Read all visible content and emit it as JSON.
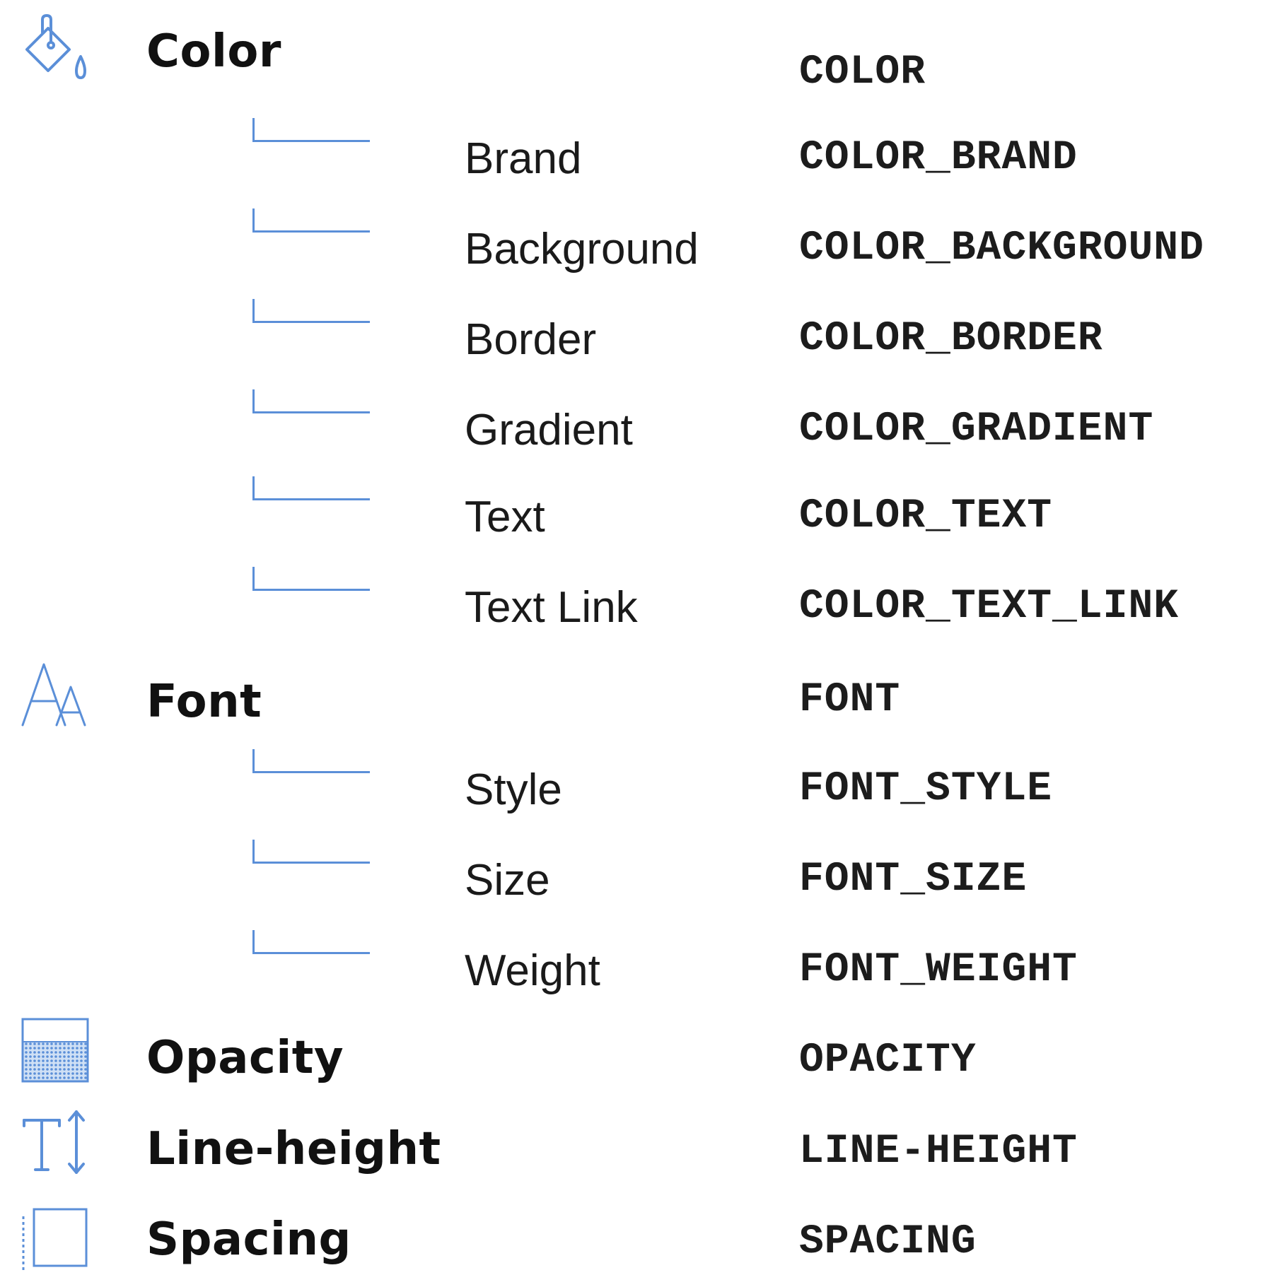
{
  "colors": {
    "icon": "#5b8fd8",
    "connector": "#5b8fd8",
    "text": "#111111"
  },
  "groups": [
    {
      "icon": "paint-bucket-icon",
      "label": "Color",
      "token": "COLOR",
      "children": [
        {
          "label": "Brand",
          "token": "COLOR_BRAND"
        },
        {
          "label": "Background",
          "token": "COLOR_BACKGROUND"
        },
        {
          "label": "Border",
          "token": "COLOR_BORDER"
        },
        {
          "label": "Gradient",
          "token": "COLOR_GRADIENT"
        },
        {
          "label": "Text",
          "token": "COLOR_TEXT"
        },
        {
          "label": "Text Link",
          "token": "COLOR_TEXT_LINK"
        }
      ]
    },
    {
      "icon": "font-icon",
      "label": "Font",
      "token": "FONT",
      "children": [
        {
          "label": "Style",
          "token": "FONT_STYLE"
        },
        {
          "label": "Size",
          "token": "FONT_SIZE"
        },
        {
          "label": "Weight",
          "token": "FONT_WEIGHT"
        }
      ]
    },
    {
      "icon": "opacity-icon",
      "label": "Opacity",
      "token": "OPACITY",
      "children": []
    },
    {
      "icon": "line-height-icon",
      "label": "Line-height",
      "token": "LINE-HEIGHT",
      "children": []
    },
    {
      "icon": "spacing-icon",
      "label": "Spacing",
      "token": "SPACING",
      "children": []
    }
  ]
}
